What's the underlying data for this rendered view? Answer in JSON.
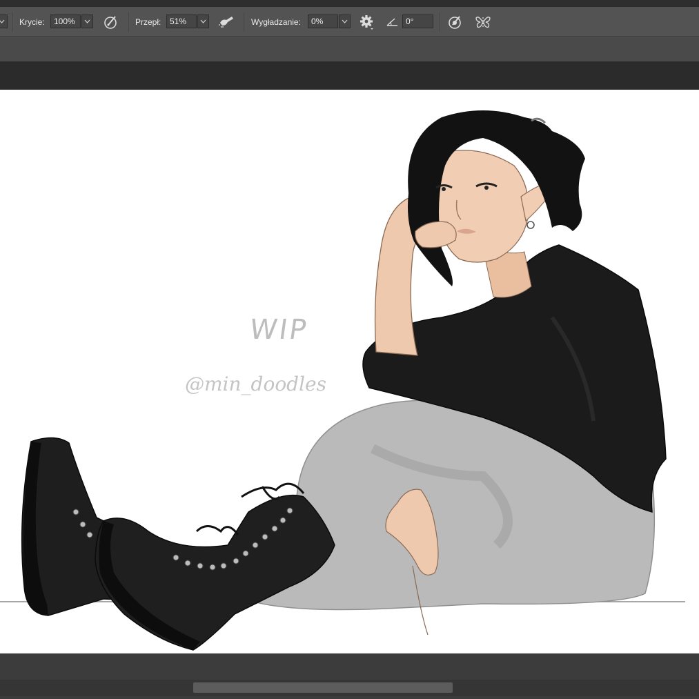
{
  "options_bar": {
    "opacity_label": "Krycie:",
    "opacity_value": "100%",
    "flow_label": "Przepł:",
    "flow_value": "51%",
    "smoothing_label": "Wygładzanie:",
    "smoothing_value": "0%",
    "angle_value": "0°"
  },
  "icons": {
    "pressure_opacity": "pen-pressure-opacity-icon",
    "airbrush": "airbrush-icon",
    "settings": "gear-icon",
    "angle": "angle-icon",
    "pressure_size": "pen-pressure-size-icon",
    "symmetry": "butterfly-symmetry-icon"
  },
  "canvas": {
    "watermark_wip": "WIP",
    "watermark_handle": "@min_doodles"
  },
  "colors": {
    "toolbar_bg": "#535353",
    "canvas_bg": "#ffffff",
    "shirt": "#1e1e1e",
    "pants": "#b9b9b9",
    "skin": "#efc9ad"
  }
}
